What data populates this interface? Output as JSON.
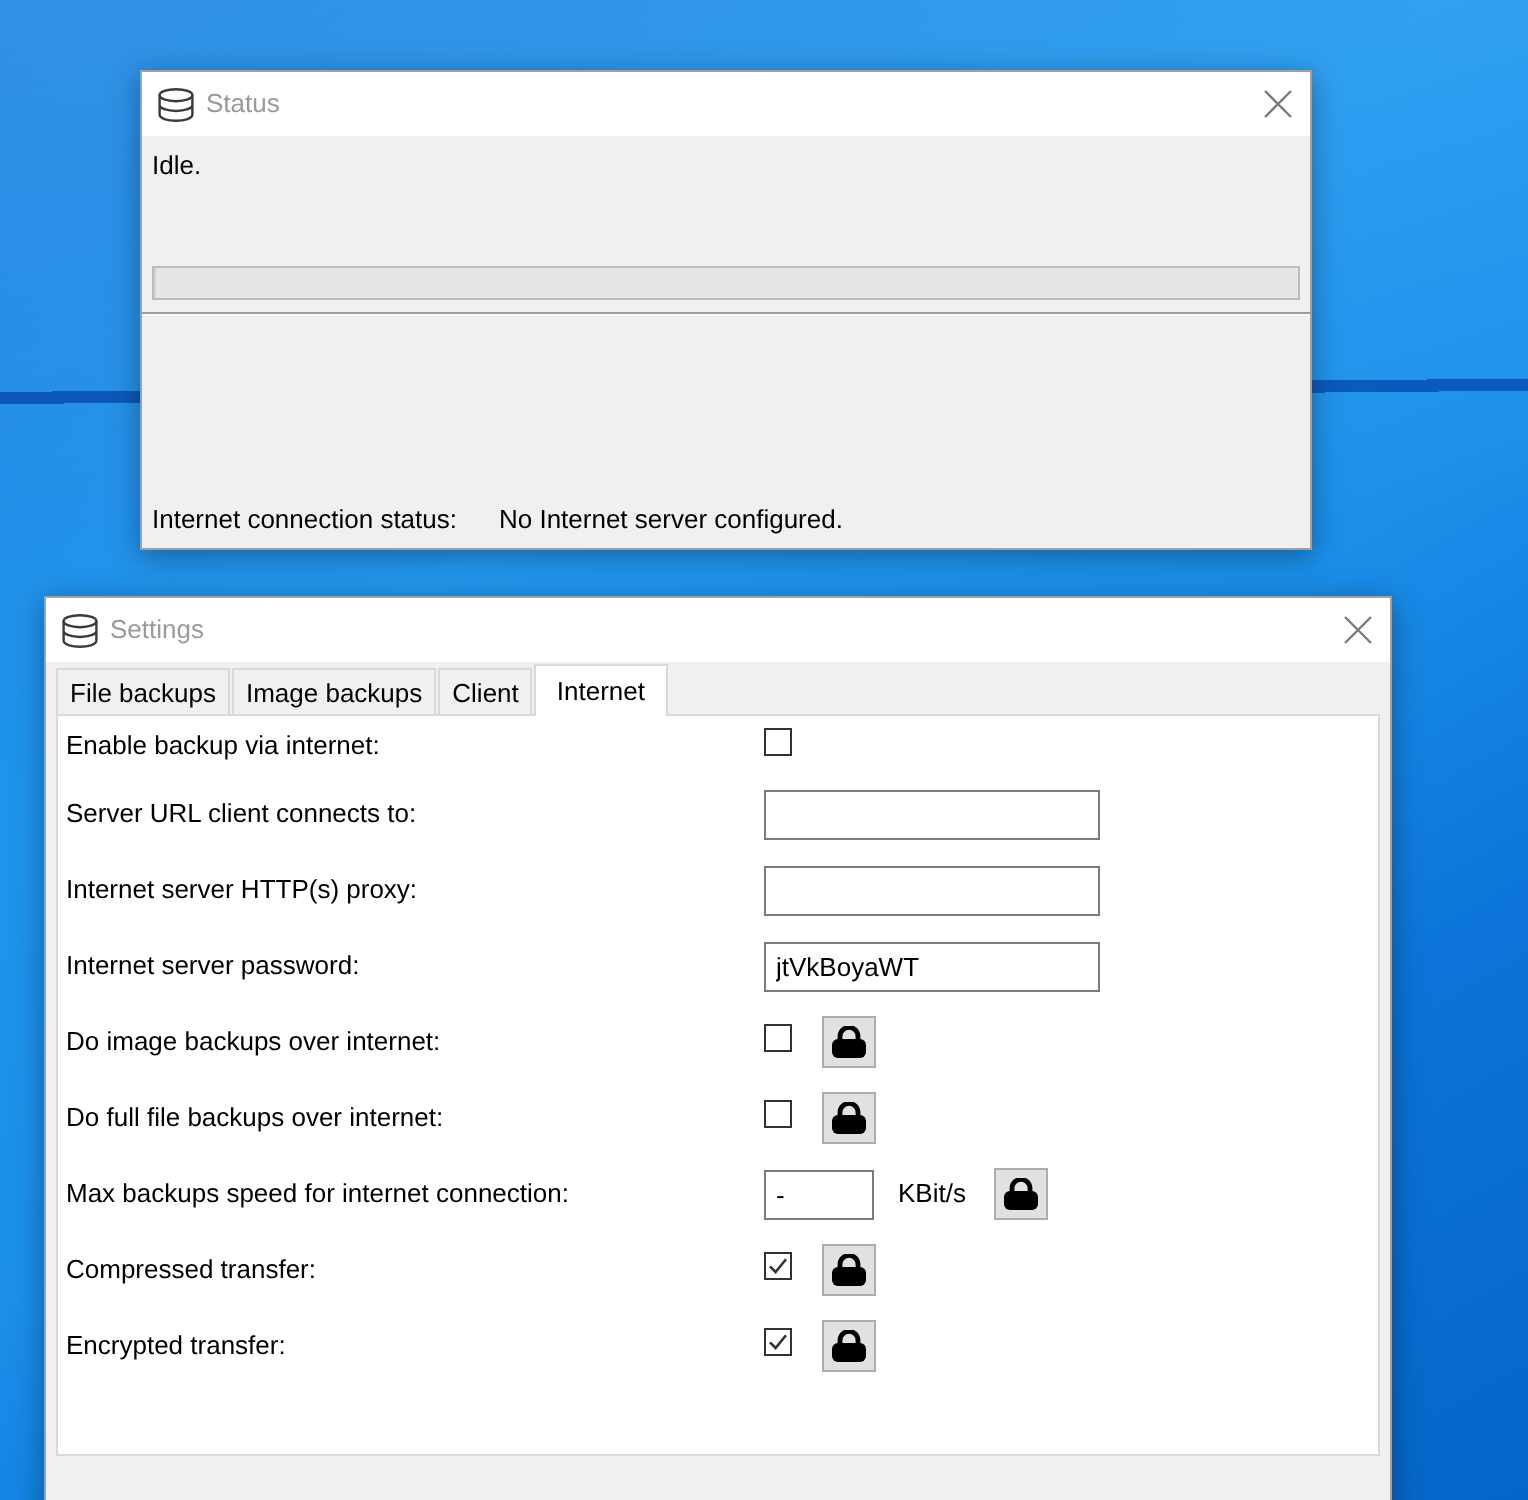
{
  "status_window": {
    "title": "Status",
    "message": "Idle.",
    "progress": {
      "level": 0
    },
    "connection": {
      "label": "Internet connection status:",
      "value": "No Internet server configured."
    }
  },
  "settings_window": {
    "title": "Settings",
    "tabs": [
      {
        "label": "File backups",
        "selected": false
      },
      {
        "label": "Image backups",
        "selected": false
      },
      {
        "label": "Client",
        "selected": false
      },
      {
        "label": "Internet",
        "selected": true
      }
    ],
    "settings": [
      {
        "kind": "checkbox",
        "label": "Enable backup via internet:",
        "checked": false
      },
      {
        "kind": "text",
        "label": "Server URL client connects to:"
      },
      {
        "kind": "text",
        "label": "Internet server HTTP(s) proxy:"
      },
      {
        "kind": "text",
        "label": "Internet server password:",
        "value": "jtVkBoyaWT"
      },
      {
        "kind": "checkbox",
        "label": "Do image backups over internet:",
        "checked": false,
        "lock": true
      },
      {
        "kind": "checkbox",
        "label": "Do full file backups over internet:",
        "checked": false,
        "lock": true
      },
      {
        "kind": "number",
        "label": "Max backups speed for internet connection:",
        "value": "-",
        "unit": "KBit/s",
        "lock": true
      },
      {
        "kind": "checkbox",
        "label": "Compressed transfer:",
        "checked": true,
        "lock": true
      },
      {
        "kind": "checkbox",
        "label": "Encrypted transfer:",
        "checked": true,
        "lock": true
      }
    ]
  }
}
